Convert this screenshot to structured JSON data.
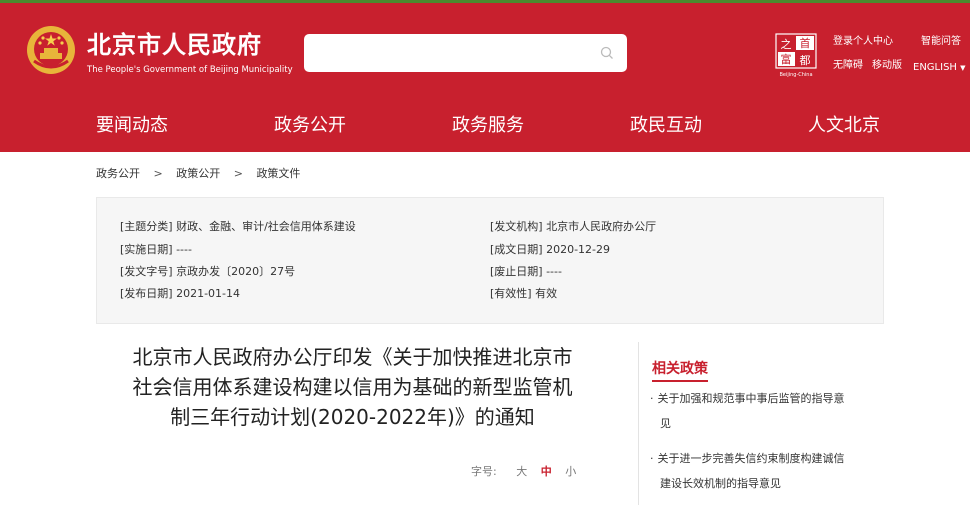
{
  "header": {
    "title": "北京市人民政府",
    "subtitle": "The People's Government of Beijing Municipality",
    "search_placeholder": "",
    "capital_logo": {
      "chars": [
        "之",
        "首",
        "富",
        "都"
      ],
      "caption": "Beijing-China"
    },
    "links": {
      "personal_center": "登录个人中心",
      "smart_qa": "智能问答",
      "accessibility": "无障碍",
      "mobile": "移动版",
      "english": "ENGLISH"
    }
  },
  "nav": {
    "items": [
      "要闻动态",
      "政务公开",
      "政务服务",
      "政民互动",
      "人文北京"
    ]
  },
  "breadcrumb": [
    "政务公开",
    "政策公开",
    "政策文件"
  ],
  "meta": {
    "left": [
      "[主题分类] 财政、金融、审计/社会信用体系建设",
      "[实施日期] ----",
      "[发文字号] 京政办发〔2020〕27号",
      "[发布日期] 2021-01-14"
    ],
    "right": [
      "[发文机构] 北京市人民政府办公厅",
      "[成文日期] 2020-12-29",
      "[废止日期] ----",
      "[有效性] 有效"
    ]
  },
  "document": {
    "title_lines": [
      "北京市人民政府办公厅印发《关于加快推进北京市",
      "社会信用体系建设构建以信用为基础的新型监管机",
      "制三年行动计划(2020-2022年)》的通知"
    ],
    "font_size": {
      "label": "字号:",
      "large": "大",
      "medium": "中",
      "small": "小",
      "selected": "中"
    }
  },
  "related": {
    "title": "相关政策",
    "items": [
      {
        "bullet": "·",
        "lines": [
          "关于加强和规范事中事后监管的指导意",
          "见"
        ]
      },
      {
        "bullet": "·",
        "lines": [
          "关于进一步完善失信约束制度构建诚信",
          "建设长效机制的指导意见"
        ]
      }
    ]
  },
  "colors": {
    "brand_red": "#c8202e",
    "top_line": "#4a8a2e",
    "meta_background": "#f6f6f6"
  }
}
